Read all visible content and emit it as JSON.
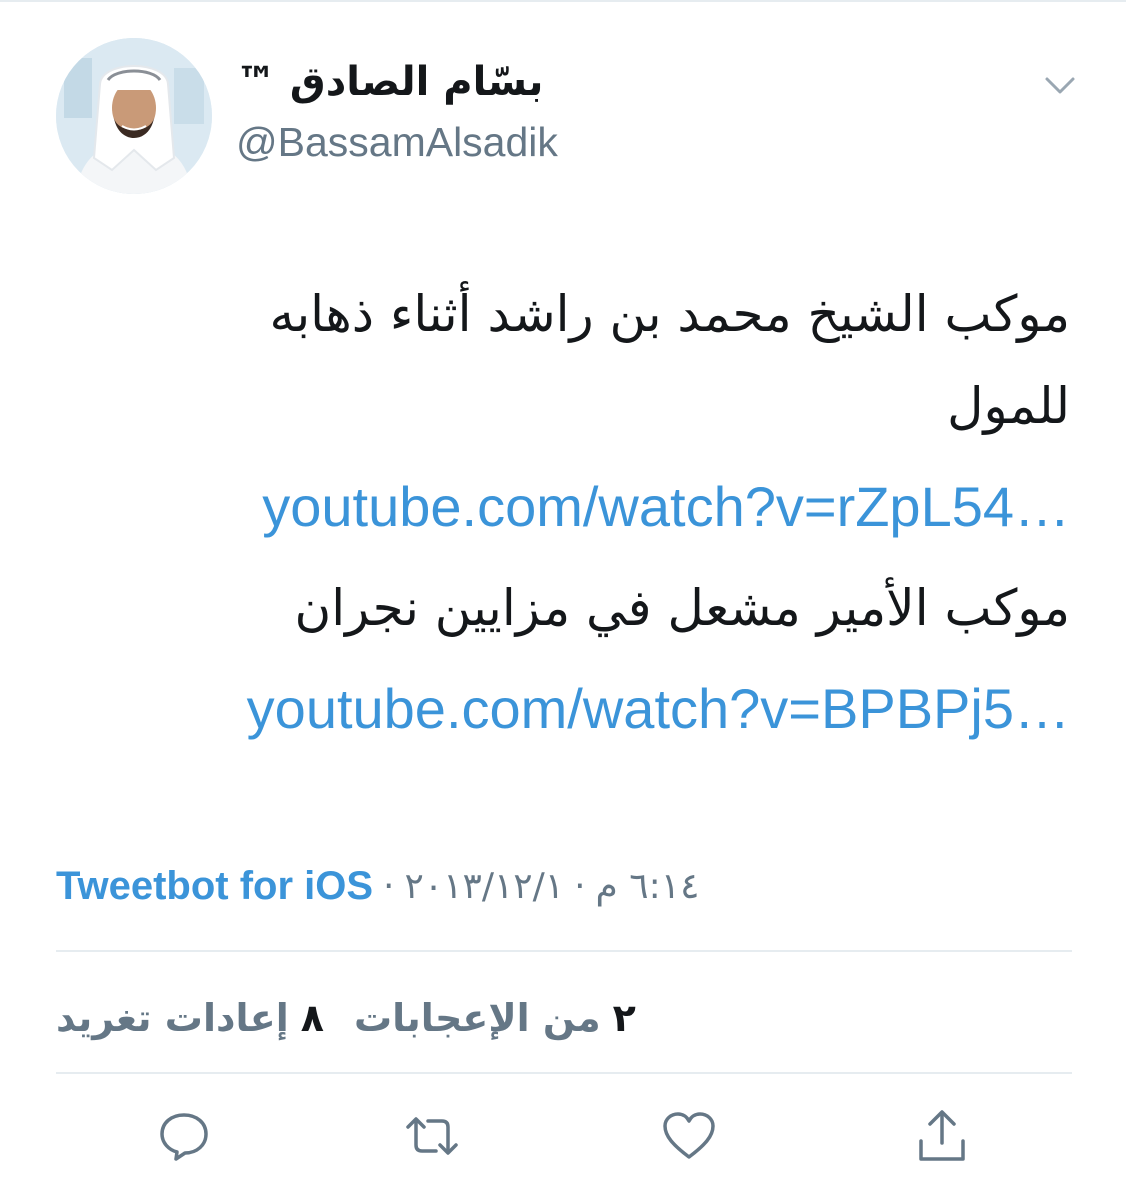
{
  "author": {
    "display_name": "بسّام الصادق ™",
    "handle": "@BassamAlsadik"
  },
  "tweet": {
    "lines": [
      "موكب الشيخ محمد بن راشد أثناء ذهابه",
      "للمول"
    ],
    "link1": "youtube.com/watch?v=rZpL54…",
    "line3": "موكب الأمير مشعل  في مزايين نجران",
    "link2": "youtube.com/watch?v=BPBPj5…"
  },
  "meta": {
    "time": "٦:١٤ م",
    "date": "٢٠١٣/١٢/١",
    "separator": "·",
    "source": "Tweetbot for iOS"
  },
  "stats": {
    "retweets_count": "٨",
    "retweets_label": "إعادات تغريد",
    "likes_count": "٢",
    "likes_label": "من الإعجابات"
  },
  "icons": {
    "menu": "chevron-down-icon",
    "reply": "reply-icon",
    "retweet": "retweet-icon",
    "like": "heart-icon",
    "share": "share-icon"
  },
  "colors": {
    "link": "#3b94d9",
    "secondary_text": "#657786",
    "divider": "#e6ecf0"
  }
}
